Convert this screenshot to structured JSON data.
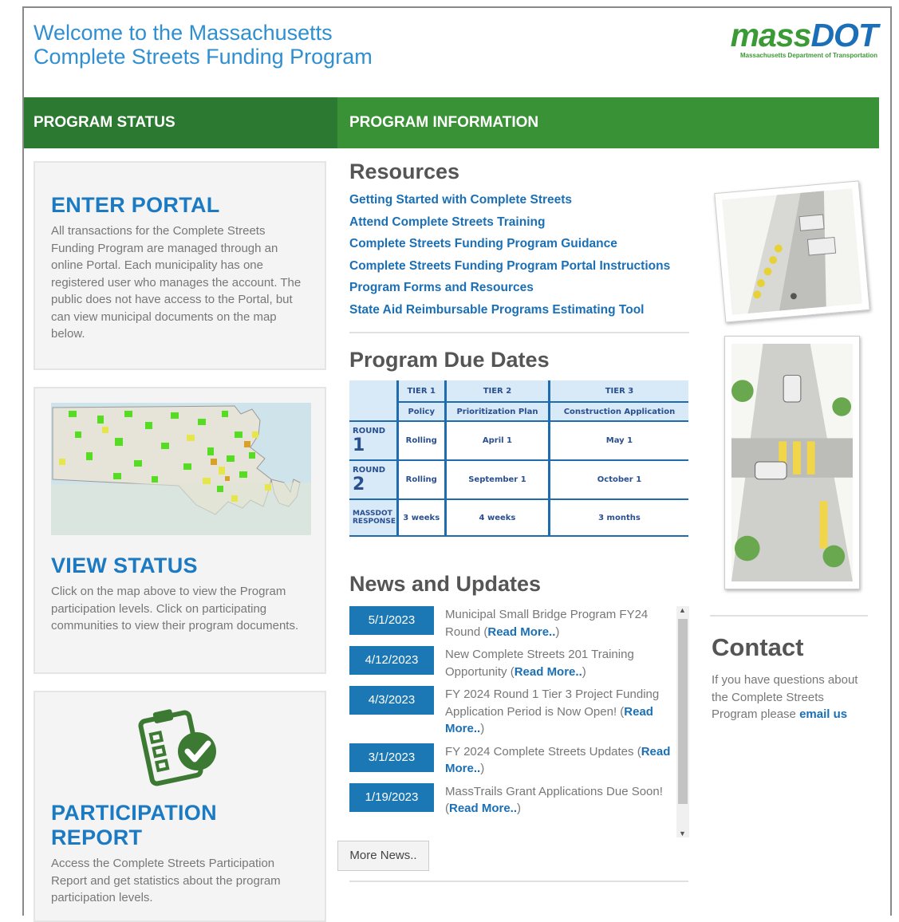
{
  "page": {
    "title_line1": "Welcome to the Massachusetts",
    "title_line2": "Complete Streets Funding Program",
    "logo_mark_1": "mass",
    "logo_mark_2": "DOT",
    "logo_subtitle": "Massachusetts Department of Transportation"
  },
  "headers": {
    "status": "PROGRAM STATUS",
    "info": "PROGRAM INFORMATION"
  },
  "cards": {
    "portal": {
      "title": "ENTER PORTAL",
      "text": "All transactions for the Complete Streets Funding Program are managed through an online Portal. Each municipality has one registered user who manages the account. The public does not have access to the Portal, but can view municipal documents on the map below."
    },
    "status": {
      "title": "VIEW STATUS",
      "text": "Click on the map above to view the Program participation levels. Click on participating communities to view their program documents."
    },
    "report": {
      "title": "PARTICIPATION REPORT",
      "text": "Access the Complete Streets Participation Report and get statistics about the program participation levels."
    }
  },
  "resources": {
    "title": "Resources",
    "links": [
      "Getting Started with Complete Streets",
      "Attend Complete Streets Training",
      "Complete Streets Funding Program Guidance",
      "Complete Streets Funding Program Portal Instructions",
      "Program Forms and Resources",
      "State Aid Reimbursable Programs Estimating Tool"
    ]
  },
  "due_dates": {
    "title": "Program Due Dates",
    "tiers": [
      "TIER 1",
      "TIER 2",
      "TIER 3"
    ],
    "tier_sub": [
      "Policy",
      "Prioritization Plan",
      "Construction Application"
    ],
    "round_label": "ROUND",
    "round1": {
      "num": "1",
      "values": [
        "Rolling",
        "April 1",
        "May 1"
      ]
    },
    "round2": {
      "num": "2",
      "values": [
        "Rolling",
        "September 1",
        "October 1"
      ]
    },
    "response_label": "MASSDOT RESPONSE",
    "response_values": [
      "3 weeks",
      "4 weeks",
      "3 months"
    ]
  },
  "news": {
    "title": "News and Updates",
    "read_more": "Read More..",
    "items": [
      {
        "date": "5/1/2023",
        "text": "Municipal Small Bridge Program FY24 Round ("
      },
      {
        "date": "4/12/2023",
        "text": "New Complete Streets 201 Training Opportunity ("
      },
      {
        "date": "4/3/2023",
        "text": "FY 2024 Round 1 Tier 3 Project Funding Application Period is Now Open! ("
      },
      {
        "date": "3/1/2023",
        "text": "FY 2024 Complete Streets Updates ("
      },
      {
        "date": "1/19/2023",
        "text": "MassTrails Grant Applications Due Soon! ("
      }
    ],
    "more_button": "More News.."
  },
  "contact": {
    "title": "Contact",
    "text": "If you have questions about the Complete Streets Program please",
    "link": "email us"
  },
  "colors": {
    "header_dark_green": "#2c7a31",
    "header_green": "#3a9236",
    "link_blue": "#1b6fb5",
    "date_blue": "#1b78b5"
  }
}
